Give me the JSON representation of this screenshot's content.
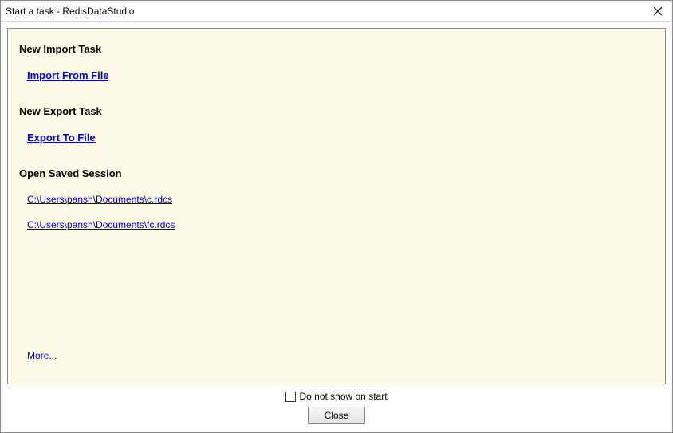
{
  "titlebar": {
    "title": "Start a task - RedisDataStudio"
  },
  "sections": {
    "import_heading": "New Import Task",
    "import_link": "Import From File",
    "export_heading": "New Export Task",
    "export_link": "Export To File",
    "session_heading": "Open Saved Session",
    "sessions": [
      "C:\\Users\\pansh\\Documents\\c.rdcs",
      "C:\\Users\\pansh\\Documents\\fc.rdcs"
    ],
    "more_link": "More..."
  },
  "footer": {
    "checkbox_label": "Do not show on start",
    "close_label": "Close"
  }
}
